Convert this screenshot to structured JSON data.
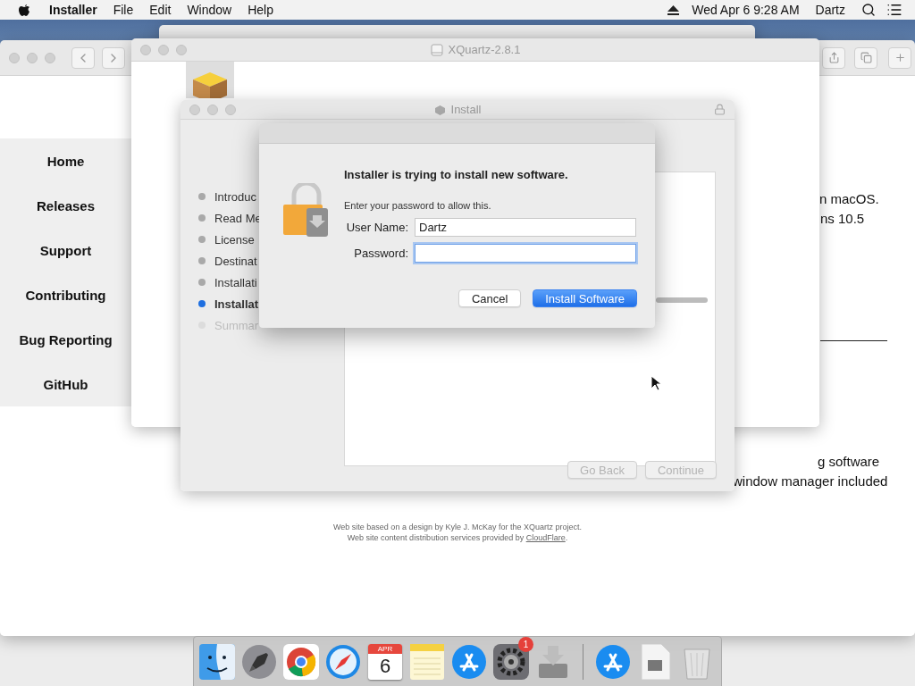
{
  "menu_bar": {
    "app": "Installer",
    "items": [
      "File",
      "Edit",
      "Window",
      "Help"
    ],
    "clock": "Wed Apr 6  9:28 AM",
    "user": "Dartz"
  },
  "browser": {
    "nav": [
      "Home",
      "Releases",
      "Support",
      "Contributing",
      "Bug Reporting",
      "GitHub"
    ],
    "right_text": [
      "n macOS.",
      "ns 10.5",
      "g software",
      "window manager included"
    ],
    "footer": [
      "Web site based on a design by Kyle J. McKay for the XQuartz project.",
      "Web site content distribution services provided by "
    ],
    "footer_link": "CloudFlare",
    "footer_end": "."
  },
  "finder_window": {
    "title": "XQuartz-2.8.1"
  },
  "installer": {
    "title": "Install",
    "steps": [
      {
        "label": "Introduc",
        "selected": false,
        "disabled": false
      },
      {
        "label": "Read Me",
        "selected": false,
        "disabled": false
      },
      {
        "label": "License",
        "selected": false,
        "disabled": false
      },
      {
        "label": "Destinat",
        "selected": false,
        "disabled": false
      },
      {
        "label": "Installati",
        "selected": false,
        "disabled": false
      },
      {
        "label": "Installat",
        "selected": true,
        "disabled": false
      },
      {
        "label": "Summar",
        "selected": false,
        "disabled": true
      }
    ],
    "progress": {
      "level": 0
    },
    "buttons": [
      {
        "label": "Go Back",
        "disabled": true
      },
      {
        "label": "Continue",
        "disabled": true
      }
    ]
  },
  "dialog": {
    "heading": "Installer is trying to install new software.",
    "message": "Enter your password to allow this.",
    "fields": [
      {
        "label": "User Name:",
        "value": "Dartz",
        "focused": false
      },
      {
        "label": "Password:",
        "focused": true
      }
    ],
    "buttons": [
      {
        "label": "Cancel",
        "kind": "secondary"
      },
      {
        "label": "Install Software",
        "kind": "primary"
      }
    ]
  },
  "dock": [
    {
      "kind": "finder"
    },
    {
      "kind": "launchpad"
    },
    {
      "kind": "chrome"
    },
    {
      "kind": "safari"
    },
    {
      "kind": "calendar",
      "month": "APR",
      "day": "6"
    },
    {
      "kind": "notes"
    },
    {
      "kind": "appstore"
    },
    {
      "kind": "settings",
      "badge": "1"
    },
    {
      "kind": "disk"
    },
    {
      "kind": "separator"
    },
    {
      "kind": "appstore"
    },
    {
      "kind": "document"
    },
    {
      "kind": "trash"
    }
  ]
}
